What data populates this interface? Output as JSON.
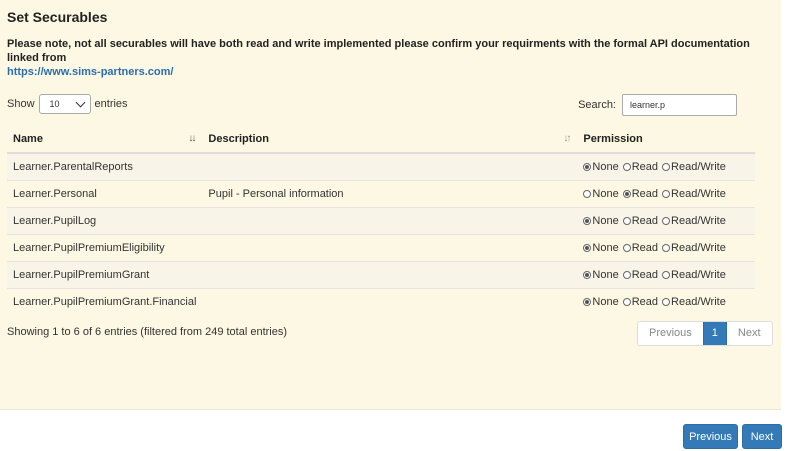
{
  "page": {
    "title": "Set Securables",
    "notice": "Please note, not all securables will have both read and write implemented please confirm your requirments with the formal API documentation linked from",
    "notice_link": "https://www.sims-partners.com/"
  },
  "length_control": {
    "show_label": "Show",
    "selected": "10",
    "entries_label": "entries"
  },
  "search": {
    "label": "Search:",
    "value": "learner.p"
  },
  "table": {
    "headers": {
      "name": "Name",
      "description": "Description",
      "permission": "Permission"
    },
    "permission_options": [
      "None",
      "Read",
      "Read/Write"
    ],
    "rows": [
      {
        "name": "Learner.ParentalReports",
        "description": "",
        "permission": "None"
      },
      {
        "name": "Learner.Personal",
        "description": "Pupil - Personal information",
        "permission": "Read"
      },
      {
        "name": "Learner.PupilLog",
        "description": "",
        "permission": "None"
      },
      {
        "name": "Learner.PupilPremiumEligibility",
        "description": "",
        "permission": "None"
      },
      {
        "name": "Learner.PupilPremiumGrant",
        "description": "",
        "permission": "None"
      },
      {
        "name": "Learner.PupilPremiumGrant.Financial",
        "description": "",
        "permission": "None"
      }
    ]
  },
  "info": "Showing 1 to 6 of 6 entries (filtered from 249 total entries)",
  "pagination": {
    "previous": "Previous",
    "current": "1",
    "next": "Next"
  },
  "wizard": {
    "previous": "Previous",
    "next": "Next"
  },
  "colors": {
    "panel_bg": "#fcf8e3",
    "primary": "#337ab7",
    "link": "#2a6db0"
  }
}
